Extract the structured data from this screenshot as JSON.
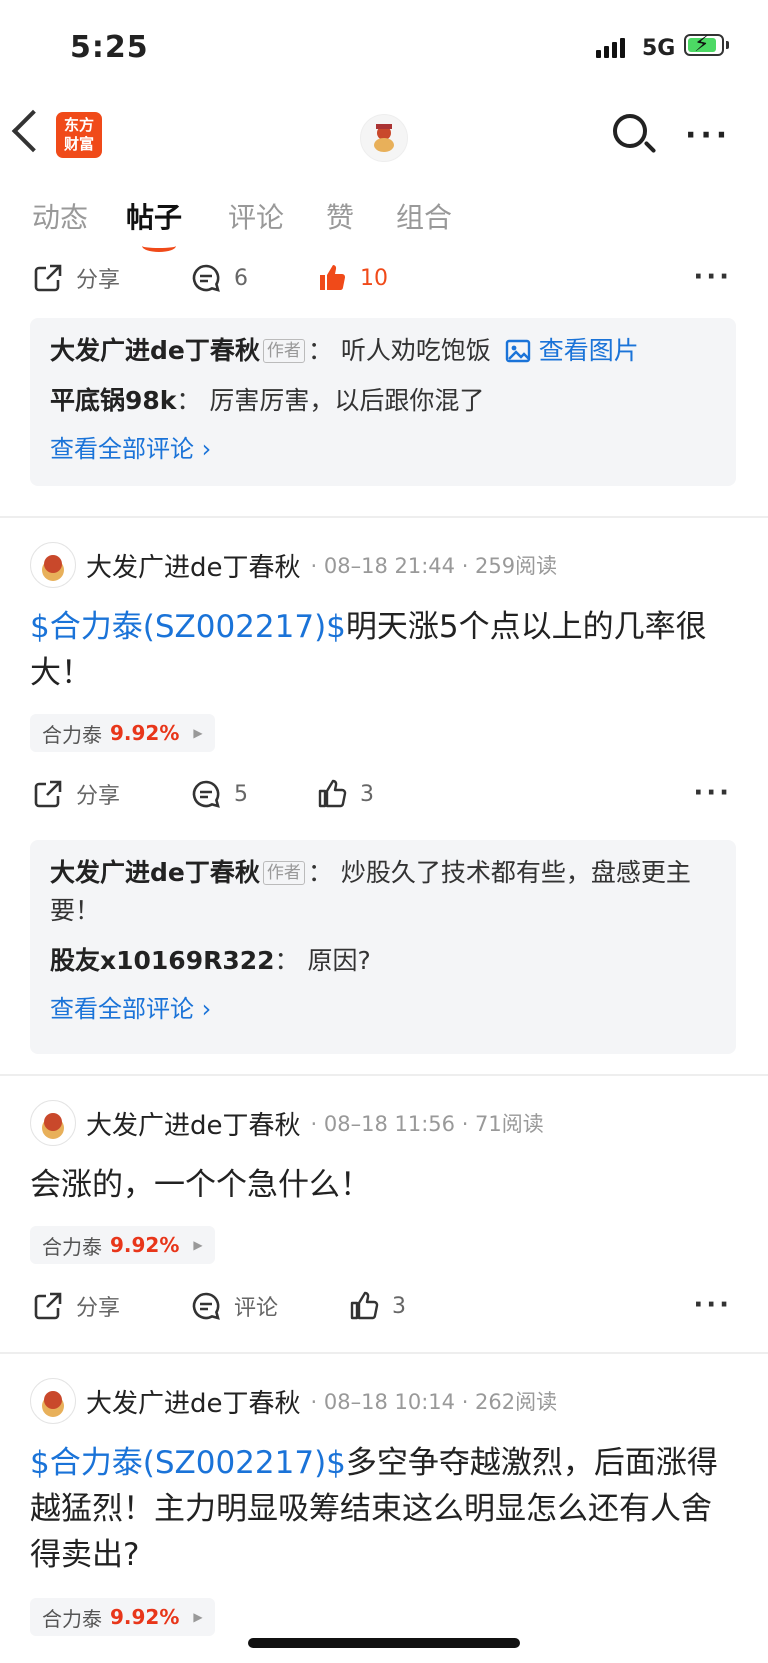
{
  "status": {
    "time": "5:25",
    "network": "5G"
  },
  "nav": {
    "logo_line1": "东方",
    "logo_line2": "财富"
  },
  "tabs": [
    {
      "label": "动态"
    },
    {
      "label": "帖子"
    },
    {
      "label": "评论"
    },
    {
      "label": "赞"
    },
    {
      "label": "组合"
    }
  ],
  "post0": {
    "share": "分享",
    "comments": "6",
    "likes": "10",
    "comment_box": [
      {
        "name": "大发广进de丁春秋",
        "author_tag": "作者",
        "text": "听人劝吃饱饭",
        "view_image": "查看图片"
      },
      {
        "name": "平底锅98k",
        "text": "厉害厉害，以后跟你混了"
      }
    ],
    "view_all": "查看全部评论"
  },
  "post1": {
    "name": "大发广进de丁春秋",
    "time": "08–18 21:44",
    "reads": "259阅读",
    "stock_link": "$合力泰(SZ002217)$",
    "text": "明天涨5个点以上的几率很大！",
    "stock_name": "合力泰",
    "stock_pct": "9.92%",
    "share": "分享",
    "comments": "5",
    "likes": "3",
    "comment_box": [
      {
        "name": "大发广进de丁春秋",
        "author_tag": "作者",
        "text": "炒股久了技术都有些，盘感更主要！"
      },
      {
        "name": "股友x10169R322",
        "text": "原因?"
      }
    ],
    "view_all": "查看全部评论"
  },
  "post2": {
    "name": "大发广进de丁春秋",
    "time": "08–18 11:56",
    "reads": "71阅读",
    "text": "会涨的，一个个急什么！",
    "stock_name": "合力泰",
    "stock_pct": "9.92%",
    "share": "分享",
    "comments": "评论",
    "likes": "3"
  },
  "post3": {
    "name": "大发广进de丁春秋",
    "time": "08–18 10:14",
    "reads": "262阅读",
    "stock_link": "$合力泰(SZ002217)$",
    "text": "多空争夺越激烈，后面涨得越猛烈！主力明显吸筹结束这么明显怎么还有人舍得卖出?",
    "stock_name": "合力泰",
    "stock_pct": "9.92%"
  },
  "colors": {
    "accent": "#f04a19",
    "link": "#1a73d8",
    "up": "#e8361a"
  }
}
